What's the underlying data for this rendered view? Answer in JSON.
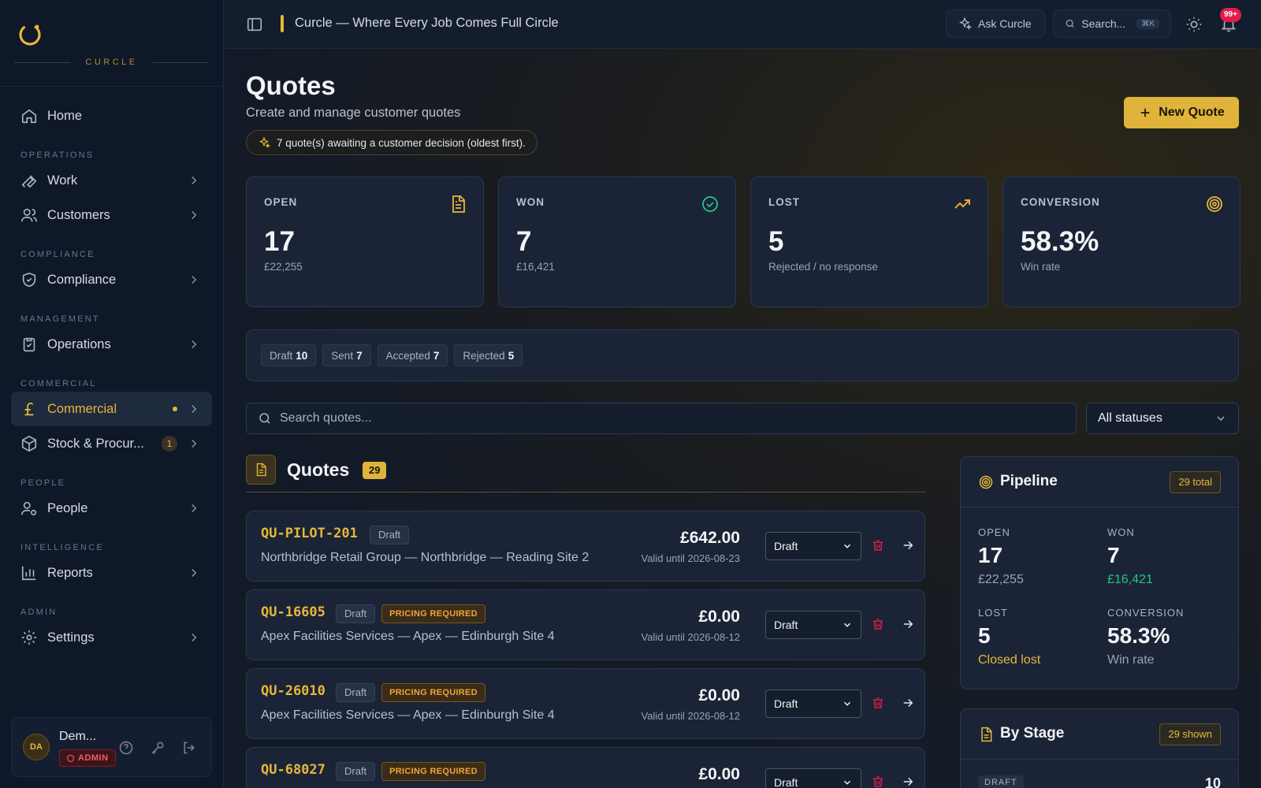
{
  "brand": {
    "name": "CURCLE"
  },
  "sidebar": {
    "home": "Home",
    "sections": {
      "operations": "OPERATIONS",
      "compliance": "COMPLIANCE",
      "management": "MANAGEMENT",
      "commercial": "COMMERCIAL",
      "people": "PEOPLE",
      "intelligence": "INTELLIGENCE",
      "admin": "ADMIN"
    },
    "items": {
      "work": "Work",
      "customers": "Customers",
      "compliance": "Compliance",
      "operations": "Operations",
      "commercial": "Commercial",
      "stock": "Stock & Procur...",
      "stock_count": "1",
      "people": "People",
      "reports": "Reports",
      "settings": "Settings"
    },
    "user": {
      "initials": "DA",
      "name": "Dem...",
      "role": "ADMIN"
    }
  },
  "topbar": {
    "title": "Curcle — Where Every Job Comes Full Circle",
    "ask": "Ask Curcle",
    "search": "Search...",
    "search_kbd": "⌘K",
    "notifications": "99+"
  },
  "page": {
    "title": "Quotes",
    "subtitle": "Create and manage customer quotes",
    "pending": "7 quote(s) awaiting a customer decision (oldest first).",
    "new_quote": "New Quote"
  },
  "stats": [
    {
      "label": "OPEN",
      "value": "17",
      "sub": "£22,255",
      "icon": "document-icon",
      "color": "#e7b73a"
    },
    {
      "label": "WON",
      "value": "7",
      "sub": "£16,421",
      "icon": "check-circle-icon",
      "color": "#22c58b"
    },
    {
      "label": "LOST",
      "value": "5",
      "sub": "Rejected / no response",
      "icon": "trending-up-icon",
      "color": "#f2a33a"
    },
    {
      "label": "CONVERSION",
      "value": "58.3%",
      "sub": "Win rate",
      "icon": "target-icon",
      "color": "#e7b73a"
    }
  ],
  "status_counts": [
    {
      "label": "Draft",
      "count": "10"
    },
    {
      "label": "Sent",
      "count": "7"
    },
    {
      "label": "Accepted",
      "count": "7"
    },
    {
      "label": "Rejected",
      "count": "5"
    }
  ],
  "filters": {
    "search_placeholder": "Search quotes...",
    "status": "All statuses"
  },
  "list": {
    "title": "Quotes",
    "count": "29"
  },
  "quotes": [
    {
      "code": "QU-PILOT-201",
      "status": "Draft",
      "pricing": "",
      "customer": "Northbridge Retail Group — Northbridge — Reading Site 2",
      "amount": "£642.00",
      "valid": "Valid until 2026-08-23",
      "select": "Draft"
    },
    {
      "code": "QU-16605",
      "status": "Draft",
      "pricing": "PRICING REQUIRED",
      "customer": "Apex Facilities Services — Apex — Edinburgh Site 4",
      "amount": "£0.00",
      "valid": "Valid until 2026-08-12",
      "select": "Draft"
    },
    {
      "code": "QU-26010",
      "status": "Draft",
      "pricing": "PRICING REQUIRED",
      "customer": "Apex Facilities Services — Apex — Edinburgh Site 4",
      "amount": "£0.00",
      "valid": "Valid until 2026-08-12",
      "select": "Draft"
    },
    {
      "code": "QU-68027",
      "status": "Draft",
      "pricing": "PRICING REQUIRED",
      "customer": "",
      "amount": "£0.00",
      "valid": "",
      "select": "Draft"
    }
  ],
  "pipeline": {
    "title": "Pipeline",
    "total": "29 total",
    "open": {
      "label": "OPEN",
      "value": "17",
      "sub": "£22,255"
    },
    "won": {
      "label": "WON",
      "value": "7",
      "sub": "£16,421"
    },
    "lost": {
      "label": "LOST",
      "value": "5",
      "sub": "Closed lost"
    },
    "conversion": {
      "label": "CONVERSION",
      "value": "58.3%",
      "sub": "Win rate"
    }
  },
  "by_stage": {
    "title": "By Stage",
    "shown": "29 shown",
    "first_stage": {
      "label": "DRAFT",
      "value": "10"
    }
  }
}
